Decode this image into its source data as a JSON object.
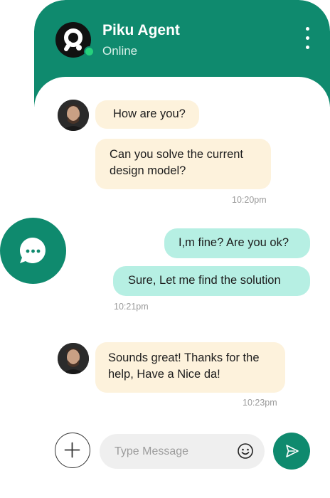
{
  "header": {
    "agent_name": "Piku Agent",
    "status": "Online",
    "brand_color": "#0f8a6e",
    "status_color": "#26d07c"
  },
  "messages": [
    {
      "direction": "incoming",
      "text": "How are you?"
    },
    {
      "direction": "incoming",
      "text": "Can you solve  the current design model?",
      "line1": "Can you solve  the current",
      "line2": "design model?",
      "time": "10:20pm"
    },
    {
      "direction": "outgoing",
      "text": "I,m fine? Are you ok?"
    },
    {
      "direction": "outgoing",
      "text": "Sure, Let me find the solution",
      "time": "10:21pm"
    },
    {
      "direction": "incoming",
      "text": "Sounds great! Thanks for the help, Have a Nice da!",
      "line1": "Sounds great! Thanks for the",
      "line2": "help, Have a Nice da!",
      "time": "10:23pm"
    }
  ],
  "composer": {
    "placeholder": "Type Message",
    "icons": [
      "plus-icon",
      "emoji-icon",
      "send-icon"
    ]
  },
  "icons": [
    "agent-logo-icon",
    "more-vertical-icon",
    "chat-bubble-icon"
  ],
  "colors": {
    "incoming_bubble": "#fdf2dc",
    "outgoing_bubble": "#b6efe3"
  }
}
